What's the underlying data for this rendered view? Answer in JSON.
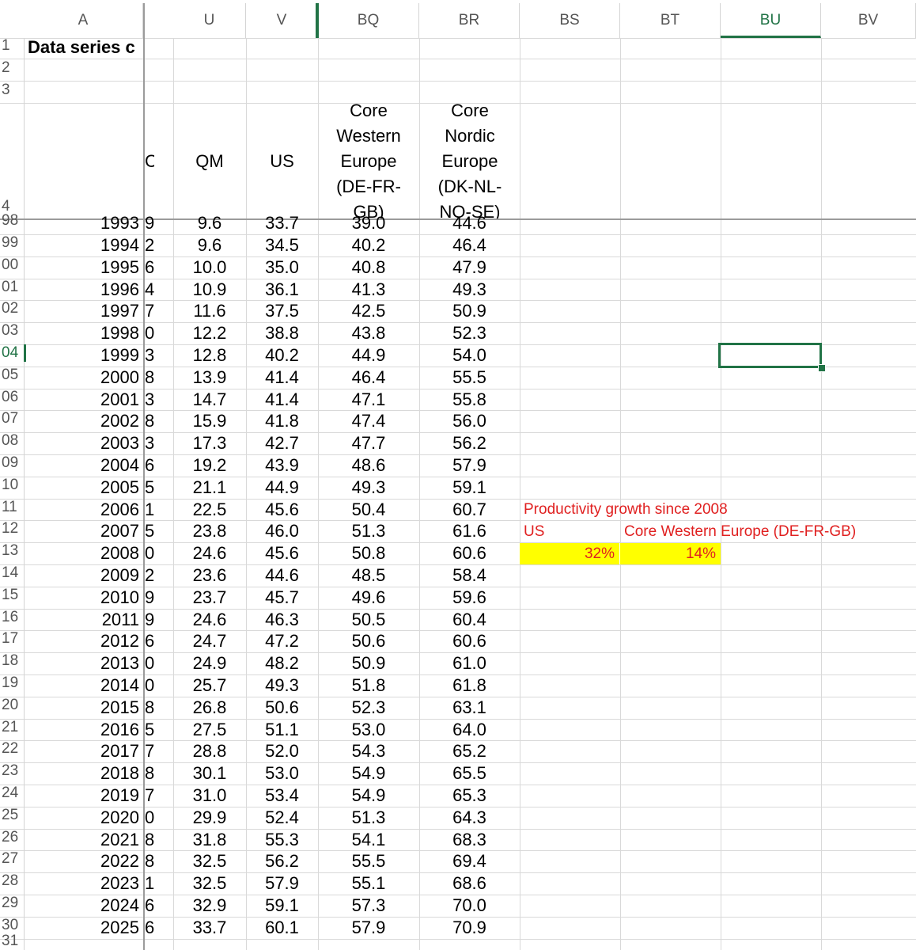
{
  "columns": [
    "A",
    "U",
    "V",
    "BQ",
    "BR",
    "BS",
    "BT",
    "BU",
    "BV"
  ],
  "selected_column": "BU",
  "title_cell": "Data series c",
  "header_row": {
    "partial_c": "C",
    "qm": "QM",
    "us": "US",
    "bq": [
      "Core",
      "Western",
      "Europe",
      "(DE-FR-",
      "GB)"
    ],
    "br": [
      "Core",
      "Nordic",
      "Europe",
      "(DK-NL-",
      "NO-SE)"
    ]
  },
  "top_rownums": [
    "1",
    "2",
    "3",
    "4"
  ],
  "rows": [
    {
      "rn": "98",
      "year": "1993",
      "c": "9",
      "qm": "9.6",
      "us": "33.7",
      "bq": "39.0",
      "br": "44.6"
    },
    {
      "rn": "99",
      "year": "1994",
      "c": "2",
      "qm": "9.6",
      "us": "34.5",
      "bq": "40.2",
      "br": "46.4"
    },
    {
      "rn": "00",
      "year": "1995",
      "c": "6",
      "qm": "10.0",
      "us": "35.0",
      "bq": "40.8",
      "br": "47.9"
    },
    {
      "rn": "01",
      "year": "1996",
      "c": "4",
      "qm": "10.9",
      "us": "36.1",
      "bq": "41.3",
      "br": "49.3"
    },
    {
      "rn": "02",
      "year": "1997",
      "c": "7",
      "qm": "11.6",
      "us": "37.5",
      "bq": "42.5",
      "br": "50.9"
    },
    {
      "rn": "03",
      "year": "1998",
      "c": "0",
      "qm": "12.2",
      "us": "38.8",
      "bq": "43.8",
      "br": "52.3"
    },
    {
      "rn": "04",
      "year": "1999",
      "c": "3",
      "qm": "12.8",
      "us": "40.2",
      "bq": "44.9",
      "br": "54.0"
    },
    {
      "rn": "05",
      "year": "2000",
      "c": "8",
      "qm": "13.9",
      "us": "41.4",
      "bq": "46.4",
      "br": "55.5"
    },
    {
      "rn": "06",
      "year": "2001",
      "c": "3",
      "qm": "14.7",
      "us": "41.4",
      "bq": "47.1",
      "br": "55.8"
    },
    {
      "rn": "07",
      "year": "2002",
      "c": "8",
      "qm": "15.9",
      "us": "41.8",
      "bq": "47.4",
      "br": "56.0"
    },
    {
      "rn": "08",
      "year": "2003",
      "c": "3",
      "qm": "17.3",
      "us": "42.7",
      "bq": "47.7",
      "br": "56.2"
    },
    {
      "rn": "09",
      "year": "2004",
      "c": "6",
      "qm": "19.2",
      "us": "43.9",
      "bq": "48.6",
      "br": "57.9"
    },
    {
      "rn": "10",
      "year": "2005",
      "c": "5",
      "qm": "21.1",
      "us": "44.9",
      "bq": "49.3",
      "br": "59.1"
    },
    {
      "rn": "11",
      "year": "2006",
      "c": "1",
      "qm": "22.5",
      "us": "45.6",
      "bq": "50.4",
      "br": "60.7"
    },
    {
      "rn": "12",
      "year": "2007",
      "c": "5",
      "qm": "23.8",
      "us": "46.0",
      "bq": "51.3",
      "br": "61.6"
    },
    {
      "rn": "13",
      "year": "2008",
      "c": "0",
      "qm": "24.6",
      "us": "45.6",
      "bq": "50.8",
      "br": "60.6"
    },
    {
      "rn": "14",
      "year": "2009",
      "c": "2",
      "qm": "23.6",
      "us": "44.6",
      "bq": "48.5",
      "br": "58.4"
    },
    {
      "rn": "15",
      "year": "2010",
      "c": "9",
      "qm": "23.7",
      "us": "45.7",
      "bq": "49.6",
      "br": "59.6"
    },
    {
      "rn": "16",
      "year": "2011",
      "c": "9",
      "qm": "24.6",
      "us": "46.3",
      "bq": "50.5",
      "br": "60.4"
    },
    {
      "rn": "17",
      "year": "2012",
      "c": "6",
      "qm": "24.7",
      "us": "47.2",
      "bq": "50.6",
      "br": "60.6"
    },
    {
      "rn": "18",
      "year": "2013",
      "c": "0",
      "qm": "24.9",
      "us": "48.2",
      "bq": "50.9",
      "br": "61.0"
    },
    {
      "rn": "19",
      "year": "2014",
      "c": "0",
      "qm": "25.7",
      "us": "49.3",
      "bq": "51.8",
      "br": "61.8"
    },
    {
      "rn": "20",
      "year": "2015",
      "c": "8",
      "qm": "26.8",
      "us": "50.6",
      "bq": "52.3",
      "br": "63.1"
    },
    {
      "rn": "21",
      "year": "2016",
      "c": "5",
      "qm": "27.5",
      "us": "51.1",
      "bq": "53.0",
      "br": "64.0"
    },
    {
      "rn": "22",
      "year": "2017",
      "c": "7",
      "qm": "28.8",
      "us": "52.0",
      "bq": "54.3",
      "br": "65.2"
    },
    {
      "rn": "23",
      "year": "2018",
      "c": "8",
      "qm": "30.1",
      "us": "53.0",
      "bq": "54.9",
      "br": "65.5"
    },
    {
      "rn": "24",
      "year": "2019",
      "c": "7",
      "qm": "31.0",
      "us": "53.4",
      "bq": "54.9",
      "br": "65.3"
    },
    {
      "rn": "25",
      "year": "2020",
      "c": "0",
      "qm": "29.9",
      "us": "52.4",
      "bq": "51.3",
      "br": "64.3"
    },
    {
      "rn": "26",
      "year": "2021",
      "c": "8",
      "qm": "31.8",
      "us": "55.3",
      "bq": "54.1",
      "br": "68.3"
    },
    {
      "rn": "27",
      "year": "2022",
      "c": "8",
      "qm": "32.5",
      "us": "56.2",
      "bq": "55.5",
      "br": "69.4"
    },
    {
      "rn": "28",
      "year": "2023",
      "c": "1",
      "qm": "32.5",
      "us": "57.9",
      "bq": "55.1",
      "br": "68.6"
    },
    {
      "rn": "29",
      "year": "2024",
      "c": "6",
      "qm": "32.9",
      "us": "59.1",
      "bq": "57.3",
      "br": "70.0"
    },
    {
      "rn": "30",
      "year": "2025",
      "c": "6",
      "qm": "33.7",
      "us": "60.1",
      "bq": "57.9",
      "br": "70.9"
    }
  ],
  "last_rownum": "31",
  "selected_rownum": "04",
  "annotation": {
    "title": "Productivity growth since 2008",
    "label_us": "US",
    "label_cwe": "Core Western Europe (DE-FR-GB)",
    "value_us": "32%",
    "value_cwe": "14%",
    "text_color": "#e02020",
    "highlight_color": "#ffff00"
  },
  "accent_color": "#217346"
}
